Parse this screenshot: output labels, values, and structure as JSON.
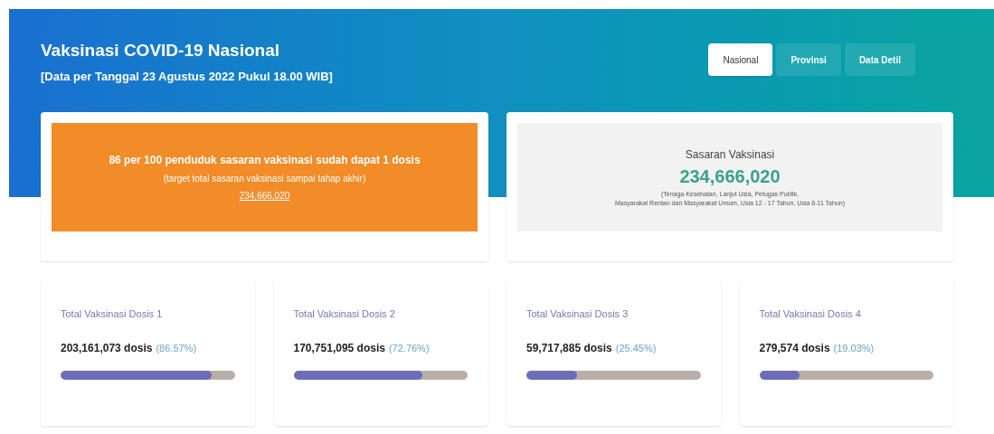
{
  "header": {
    "title": "Vaksinasi COVID-19 Nasional",
    "subtitle": "[Data per Tanggal 23 Agustus 2022 Pukul 18.00 WIB]"
  },
  "tabs": [
    {
      "label": "Nasional",
      "selected": true
    },
    {
      "label": "Provinsi",
      "selected": false
    },
    {
      "label": "Data Detil",
      "selected": false
    }
  ],
  "progress_panel": {
    "headline": "86 per 100 penduduk sasaran vaksinasi sudah dapat **1 dosis**",
    "note": "(target total sasaran vaksinasi sampai tahap akhir)",
    "target": "234,666,020"
  },
  "target_panel": {
    "title": "Sasaran Vaksinasi",
    "value": "234,666,020",
    "note_line_1": "(Tenaga Kesehatan, Lanjut Usia, Petugas Publik,",
    "note_line_2": "Masyarakat Rentan dan Masyarakat Umum, Usia 12 - 17 Tahun, Usia 6-11 Tahun)"
  },
  "dose_cards": [
    {
      "title": "Total Vaksinasi Dosis 1",
      "count": "203,161,073 dosis",
      "percent": "(86.57%)",
      "level": 0.87
    },
    {
      "title": "Total Vaksinasi Dosis 2",
      "count": "170,751,095 dosis",
      "percent": "(72.76%)",
      "level": 0.74
    },
    {
      "title": "Total Vaksinasi Dosis 3",
      "count": "59,717,885 dosis",
      "percent": "(25.45%)",
      "level": 0.29
    },
    {
      "title": "Total Vaksinasi Dosis 4",
      "count": "279,574 dosis",
      "percent": "(19.03%)",
      "level": 0.23
    }
  ]
}
